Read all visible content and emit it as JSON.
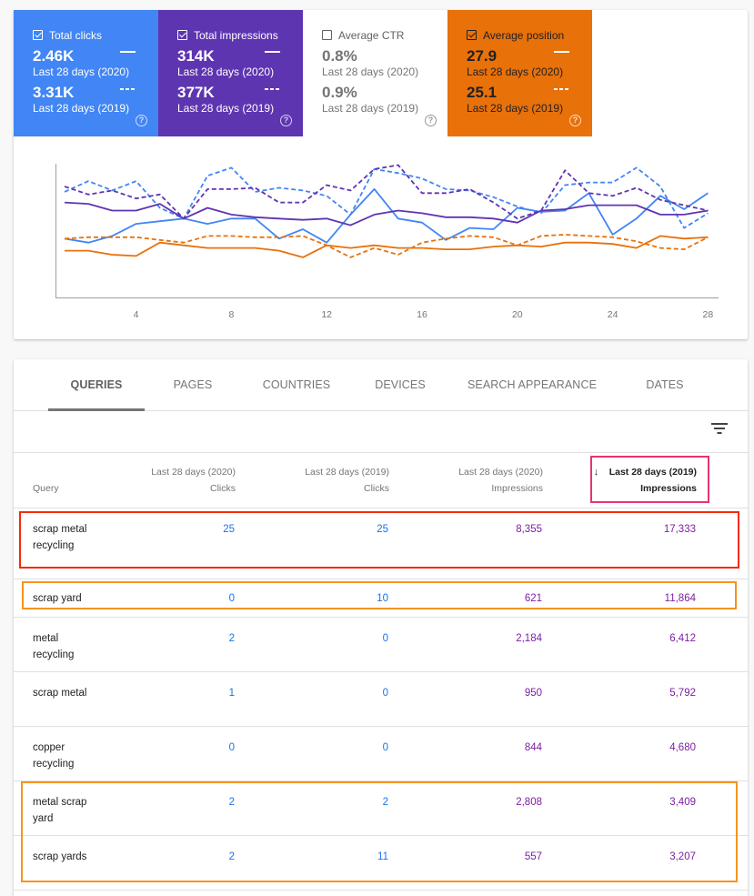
{
  "metrics": [
    {
      "id": "clicks",
      "label": "Total clicks",
      "checked": true,
      "value_a": "2.46K",
      "period_a": "Last 28 days (2020)",
      "value_b": "3.31K",
      "period_b": "Last 28 days (2019)",
      "color": "#4285f4"
    },
    {
      "id": "impressions",
      "label": "Total impressions",
      "checked": true,
      "value_a": "314K",
      "period_a": "Last 28 days (2020)",
      "value_b": "377K",
      "period_b": "Last 28 days (2019)",
      "color": "#5e35b1"
    },
    {
      "id": "ctr",
      "label": "Average CTR",
      "checked": false,
      "value_a": "0.8%",
      "period_a": "Last 28 days (2020)",
      "value_b": "0.9%",
      "period_b": "Last 28 days (2019)",
      "color": "#ffffff"
    },
    {
      "id": "position",
      "label": "Average position",
      "checked": true,
      "value_a": "27.9",
      "period_a": "Last 28 days (2020)",
      "value_b": "25.1",
      "period_b": "Last 28 days (2019)",
      "color": "#e8710a"
    }
  ],
  "help_icon_glyph": "?",
  "chart_data": {
    "type": "line",
    "title": "",
    "xlabel": "",
    "ylabel": "",
    "x": [
      1,
      2,
      3,
      4,
      5,
      6,
      7,
      8,
      9,
      10,
      11,
      12,
      13,
      14,
      15,
      16,
      17,
      18,
      19,
      20,
      21,
      22,
      23,
      24,
      25,
      26,
      27,
      28
    ],
    "x_ticks": [
      "4",
      "8",
      "12",
      "16",
      "20",
      "24",
      "28"
    ],
    "x_tick_values": [
      4,
      8,
      12,
      16,
      20,
      24,
      28
    ],
    "ylim": [
      0,
      100
    ],
    "y_note": "no y-axis labels shown; values are relative (normalized 0-100)",
    "grid": false,
    "legend": "none",
    "series": [
      {
        "name": "Clicks (2020)",
        "color": "#4285f4",
        "dashed": false,
        "values": [
          44,
          41,
          46,
          55,
          57,
          59,
          55,
          59,
          59,
          44,
          51,
          41,
          62,
          81,
          59,
          56,
          43,
          52,
          51,
          67,
          64,
          65,
          78,
          47,
          59,
          76,
          66,
          78
        ]
      },
      {
        "name": "Clicks (2019)",
        "color": "#4285f4",
        "dashed": true,
        "values": [
          79,
          87,
          80,
          87,
          67,
          59,
          91,
          97,
          79,
          82,
          80,
          76,
          62,
          96,
          93,
          89,
          81,
          80,
          75,
          68,
          63,
          84,
          86,
          86,
          97,
          83,
          52,
          63
        ]
      },
      {
        "name": "Impressions (2020)",
        "color": "#5e35b1",
        "dashed": false,
        "values": [
          71,
          70,
          65,
          65,
          70,
          59,
          67,
          62,
          60,
          59,
          58,
          59,
          54,
          62,
          65,
          63,
          60,
          60,
          59,
          56,
          65,
          66,
          69,
          69,
          69,
          62,
          62,
          65
        ]
      },
      {
        "name": "Impressions (2019)",
        "color": "#5e35b1",
        "dashed": true,
        "values": [
          83,
          77,
          80,
          74,
          77,
          59,
          81,
          81,
          82,
          71,
          71,
          84,
          80,
          96,
          99,
          78,
          78,
          81,
          71,
          59,
          65,
          95,
          78,
          76,
          82,
          73,
          69,
          65
        ]
      },
      {
        "name": "Position (2020)",
        "color": "#e8710a",
        "dashed": false,
        "values": [
          35,
          35,
          32,
          31,
          41,
          39,
          37,
          37,
          37,
          35,
          30,
          39,
          37,
          39,
          37,
          37,
          36,
          36,
          38,
          39,
          38,
          41,
          41,
          40,
          37,
          46,
          44,
          45
        ]
      },
      {
        "name": "Position (2019)",
        "color": "#e8710a",
        "dashed": true,
        "values": [
          44,
          45,
          45,
          45,
          43,
          41,
          46,
          46,
          45,
          45,
          46,
          39,
          30,
          37,
          32,
          41,
          44,
          46,
          45,
          39,
          46,
          47,
          46,
          45,
          42,
          37,
          36,
          45
        ]
      }
    ]
  },
  "tabs": [
    {
      "label": "QUERIES",
      "active": true
    },
    {
      "label": "PAGES",
      "active": false
    },
    {
      "label": "COUNTRIES",
      "active": false
    },
    {
      "label": "DEVICES",
      "active": false
    },
    {
      "label": "SEARCH APPEARANCE",
      "active": false
    },
    {
      "label": "DATES",
      "active": false
    }
  ],
  "table": {
    "filter_icon": "filter-list-icon",
    "sort_arrow": "↓",
    "columns": [
      {
        "line1": "",
        "line2": "Query"
      },
      {
        "line1": "Last 28 days (2020)",
        "line2": "Clicks"
      },
      {
        "line1": "Last 28 days (2019)",
        "line2": "Clicks"
      },
      {
        "line1": "Last 28 days (2020)",
        "line2": "Impressions"
      },
      {
        "line1": "Last 28 days (2019)",
        "line2": "Impressions",
        "sorted": "desc"
      }
    ],
    "rows": [
      {
        "query": "scrap metal recycling",
        "clicks_2020": "25",
        "clicks_2019": "25",
        "impr_2020": "8,355",
        "impr_2019": "17,333",
        "highlight": "red"
      },
      {
        "query": "scrap yard",
        "clicks_2020": "0",
        "clicks_2019": "10",
        "impr_2020": "621",
        "impr_2019": "11,864",
        "highlight": "orange"
      },
      {
        "query": "metal recycling",
        "clicks_2020": "2",
        "clicks_2019": "0",
        "impr_2020": "2,184",
        "impr_2019": "6,412"
      },
      {
        "query": "scrap metal",
        "clicks_2020": "1",
        "clicks_2019": "0",
        "impr_2020": "950",
        "impr_2019": "5,792"
      },
      {
        "query": "copper recycling",
        "clicks_2020": "0",
        "clicks_2019": "0",
        "impr_2020": "844",
        "impr_2019": "4,680"
      },
      {
        "query": "metal scrap yard",
        "clicks_2020": "2",
        "clicks_2019": "2",
        "impr_2020": "2,808",
        "impr_2019": "3,409",
        "highlight": "orange-group"
      },
      {
        "query": "scrap yards",
        "clicks_2020": "2",
        "clicks_2019": "11",
        "impr_2020": "557",
        "impr_2019": "3,207",
        "highlight": "orange-group"
      }
    ]
  },
  "colors": {
    "clicks": "#4285f4",
    "impressions": "#5e35b1",
    "position": "#e8710a",
    "highlight_red": "#f62a0a",
    "highlight_orange": "#f7931e",
    "highlight_pink": "#e8336d"
  }
}
